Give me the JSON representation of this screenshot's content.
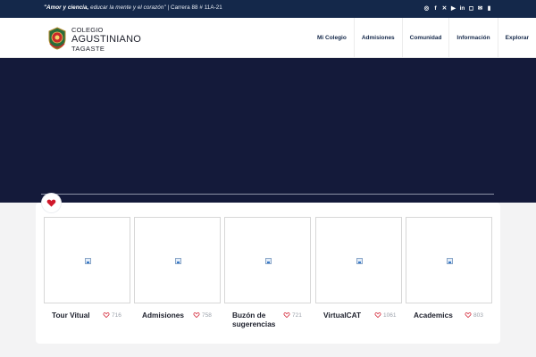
{
  "topbar": {
    "tagline_em": "\"Amor y ciencia,",
    "tagline_it": " educar la mente y el corazón\"",
    "tagline_rest": " | Carrera 88 # 11A-21",
    "socials": [
      {
        "icon": "whatsapp-icon",
        "glyph": "◎"
      },
      {
        "icon": "facebook-icon",
        "glyph": "f"
      },
      {
        "icon": "x-icon",
        "glyph": "✕"
      },
      {
        "icon": "youtube-icon",
        "glyph": "▶"
      },
      {
        "icon": "linkedin-icon",
        "glyph": "in"
      },
      {
        "icon": "instagram-icon",
        "glyph": "◻"
      },
      {
        "icon": "mail-icon",
        "glyph": "✉"
      },
      {
        "icon": "document-icon",
        "glyph": "▮"
      }
    ]
  },
  "header": {
    "logo_line1": "COLEGIO",
    "logo_line2": "AGUSTINIANO",
    "logo_line3": "TAGASTE",
    "nav": [
      "Mi Colegio",
      "Admisiones",
      "Comunidad",
      "Información",
      "Explorar"
    ]
  },
  "cards": [
    {
      "title": "Tour Vitual",
      "likes": "716"
    },
    {
      "title": "Admisiones",
      "likes": "758"
    },
    {
      "title": "Buzón de sugerencias",
      "likes": "721"
    },
    {
      "title": "VirtualCAT",
      "likes": "1061"
    },
    {
      "title": "Academics",
      "likes": "803"
    }
  ],
  "colors": {
    "topbar": "#14284a",
    "hero": "#141a3a",
    "heart": "#d0182a"
  }
}
